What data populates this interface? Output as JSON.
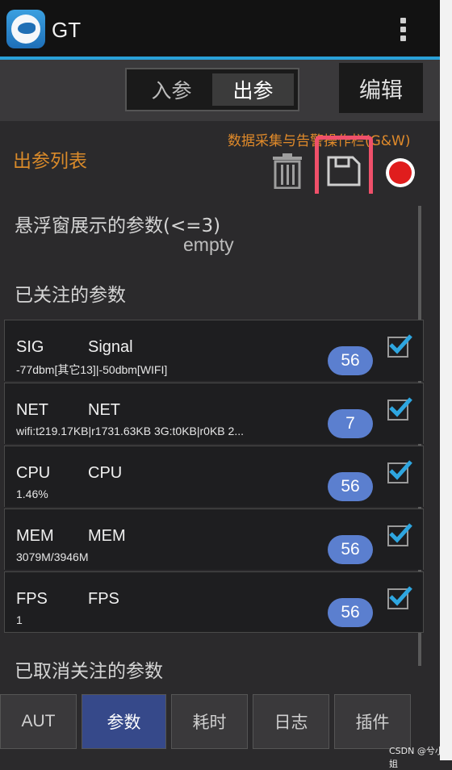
{
  "app": {
    "name": "GT"
  },
  "mode_toggle": {
    "in_label": "入参",
    "out_label": "出参",
    "edit_label": "编辑"
  },
  "header": {
    "title": "出参列表",
    "annotation": "数据采集与告警操作栏(G&W)"
  },
  "sections": {
    "floating": "悬浮窗展示的参数(<=3)",
    "floating_empty": "empty",
    "followed": "已关注的参数",
    "cancelled": "已取消关注的参数"
  },
  "params": [
    {
      "key": "SIG",
      "name": "Signal",
      "value": "-77dbm[其它13]|-50dbm[WIFI]",
      "badge": "56",
      "checked": true
    },
    {
      "key": "NET",
      "name": "NET",
      "value": "wifi:t219.17KB|r1731.63KB  3G:t0KB|r0KB  2...",
      "badge": "7",
      "checked": true
    },
    {
      "key": "CPU",
      "name": "CPU",
      "value": "1.46%",
      "badge": "56",
      "checked": true
    },
    {
      "key": "MEM",
      "name": "MEM",
      "value": "3079M/3946M",
      "badge": "56",
      "checked": true
    },
    {
      "key": "FPS",
      "name": "FPS",
      "value": "1",
      "badge": "56",
      "checked": true
    }
  ],
  "bottom_nav": [
    {
      "label": "AUT",
      "active": false
    },
    {
      "label": "参数",
      "active": true
    },
    {
      "label": "耗时",
      "active": false
    },
    {
      "label": "日志",
      "active": false
    },
    {
      "label": "插件",
      "active": false
    }
  ],
  "watermark": "CSDN @兮小姐",
  "colors": {
    "accent": "#2aa0d8",
    "highlight": "#f0506a",
    "badge": "#5b7fcf",
    "active_tab": "#36498a",
    "title_orange": "#d98a2a"
  },
  "icons": [
    "app-logo-icon",
    "overflow-menu-icon",
    "trash-icon",
    "save-icon",
    "record-icon",
    "check-icon"
  ]
}
